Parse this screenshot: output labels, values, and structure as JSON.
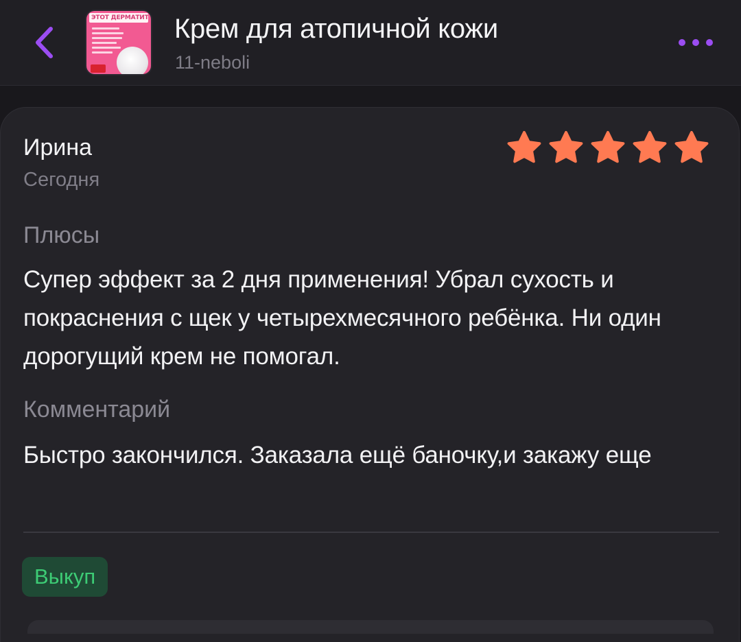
{
  "header": {
    "title": "Крем для атопичной кожи",
    "subtitle": "11-neboli",
    "thumbnail_banner": "ЭТОТ ДЕРМАТИТ",
    "back_icon": "chevron-left-icon",
    "more_icon": "more-dots-icon",
    "accent_color": "#9b4df2"
  },
  "review": {
    "author": "Ирина",
    "date": "Сегодня",
    "rating": 5,
    "rating_max": 5,
    "star_color": "#ff7a52",
    "pros_label": "Плюсы",
    "pros_text": "Супер эффект за 2 дня применения! Убрал сухость и покраснения с щек у четырехмесячного ребёнка. Ни один дорогущий крем не помогал.",
    "comment_label": "Комментарий",
    "comment_text": "Быстро закончился. Заказала ещё баночку,и закажу еще",
    "badge": "Выкуп",
    "badge_color": "#3dcc75"
  }
}
